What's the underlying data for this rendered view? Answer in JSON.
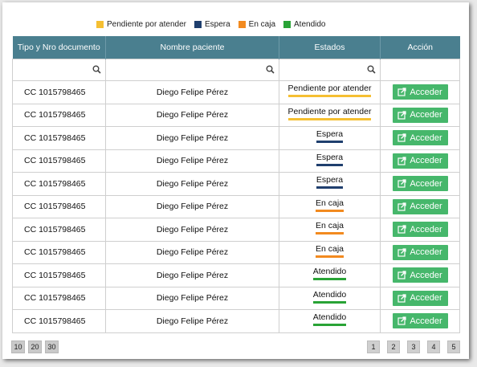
{
  "legend": [
    {
      "label": "Pendiente por atender",
      "color": "#f5bf32"
    },
    {
      "label": "Espera",
      "color": "#1f3f6e"
    },
    {
      "label": "En caja",
      "color": "#f28a1f"
    },
    {
      "label": "Atendido",
      "color": "#29a336"
    }
  ],
  "table": {
    "headers": [
      "Tipo y Nro documento",
      "Nombre paciente",
      "Estados",
      "Acción"
    ],
    "rows": [
      {
        "doc": "CC 1015798465",
        "name": "Diego Felipe Pérez",
        "status": "Pendiente por atender",
        "status_color": "#f5bf32",
        "action": "Acceder"
      },
      {
        "doc": "CC 1015798465",
        "name": "Diego Felipe Pérez",
        "status": "Pendiente por atender",
        "status_color": "#f5bf32",
        "action": "Acceder"
      },
      {
        "doc": "CC 1015798465",
        "name": "Diego Felipe Pérez",
        "status": "Espera",
        "status_color": "#1f3f6e",
        "action": "Acceder"
      },
      {
        "doc": "CC 1015798465",
        "name": "Diego Felipe Pérez",
        "status": "Espera",
        "status_color": "#1f3f6e",
        "action": "Acceder"
      },
      {
        "doc": "CC 1015798465",
        "name": "Diego Felipe Pérez",
        "status": "Espera",
        "status_color": "#1f3f6e",
        "action": "Acceder"
      },
      {
        "doc": "CC 1015798465",
        "name": "Diego Felipe Pérez",
        "status": "En caja",
        "status_color": "#f28a1f",
        "action": "Acceder"
      },
      {
        "doc": "CC 1015798465",
        "name": "Diego Felipe Pérez",
        "status": "En caja",
        "status_color": "#f28a1f",
        "action": "Acceder"
      },
      {
        "doc": "CC 1015798465",
        "name": "Diego Felipe Pérez",
        "status": "En caja",
        "status_color": "#f28a1f",
        "action": "Acceder"
      },
      {
        "doc": "CC 1015798465",
        "name": "Diego Felipe Pérez",
        "status": "Atendido",
        "status_color": "#29a336",
        "action": "Acceder"
      },
      {
        "doc": "CC 1015798465",
        "name": "Diego Felipe Pérez",
        "status": "Atendido",
        "status_color": "#29a336",
        "action": "Acceder"
      },
      {
        "doc": "CC 1015798465",
        "name": "Diego Felipe Pérez",
        "status": "Atendido",
        "status_color": "#29a336",
        "action": "Acceder"
      }
    ]
  },
  "page_size_options": [
    "10",
    "20",
    "30"
  ],
  "pages": [
    "1",
    "2",
    "3",
    "4",
    "5"
  ],
  "icons": {
    "filter": "search-icon",
    "action": "external-link-icon"
  },
  "colors": {
    "header_bg": "#4a7f8f",
    "button_bg": "#46b76b"
  }
}
